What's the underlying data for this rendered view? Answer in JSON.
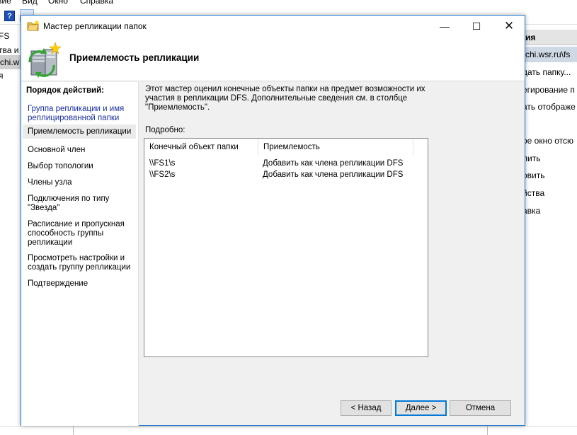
{
  "background_window": {
    "menu": [
      "вие",
      "Вид",
      "Окно",
      "Справка"
    ],
    "tree_items": [
      "FS",
      "тва и",
      "chi.w",
      "я"
    ],
    "actions_header": "ия",
    "actions_subheader": "chi.wsr.ru\\fs",
    "actions": [
      "дать папку...",
      "егирование п",
      "ать отображе",
      "ое окно отсю",
      "лить",
      "овить",
      "йства",
      "авка"
    ]
  },
  "dialog": {
    "title": "Мастер репликации папок",
    "header_title": "Приемлемость репликации",
    "steps_heading": "Порядок действий:",
    "steps": [
      {
        "label": "Группа репликации и имя реплицированной папки"
      },
      {
        "label": "Приемлемость репликации"
      },
      {
        "label": "Основной член"
      },
      {
        "label": "Выбор топологии"
      },
      {
        "label": "Члены узла"
      },
      {
        "label": "Подключения по типу \"Звезда\""
      },
      {
        "label": "Расписание и пропускная способность группы репликации"
      },
      {
        "label": "Просмотреть настройки и создать группу репликации"
      },
      {
        "label": "Подтверждение"
      }
    ],
    "description": "Этот мастер оценил конечные объекты папки на предмет возможности их участия в репликации DFS. Дополнительные сведения см. в столбце \"Приемлемость\".",
    "details_label": "Подробно:",
    "table": {
      "columns": [
        "Конечный объект папки",
        "Приемлемость"
      ],
      "rows": [
        [
          "\\\\FS1\\s",
          "Добавить как члена репликации DFS"
        ],
        [
          "\\\\FS2\\s",
          "Добавить как члена репликации DFS"
        ]
      ]
    },
    "buttons": {
      "back": "< Назад",
      "next": "Далее >",
      "cancel": "Отмена"
    }
  },
  "colors": {
    "dialog_border": "#1e7ad3",
    "link_text": "#1a2fa0",
    "default_button_border": "#0078d7"
  },
  "icons": [
    "help-icon",
    "wizard-folder-icon",
    "minimize-icon",
    "maximize-icon",
    "close-icon",
    "server-replication-icon"
  ]
}
